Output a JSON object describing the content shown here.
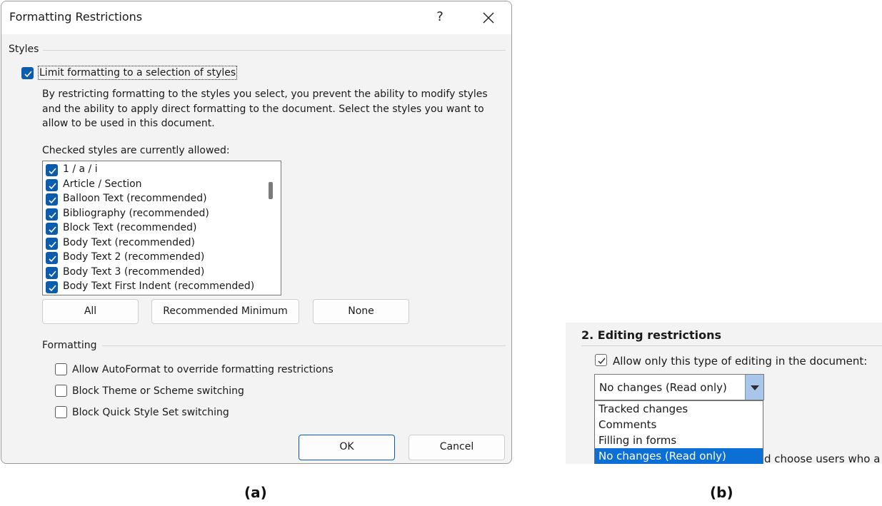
{
  "dialog": {
    "title": "Formatting Restrictions",
    "help_label": "?",
    "styles_group": "Styles",
    "limit_checkbox": {
      "label": "Limit formatting to a selection of styles",
      "checked": true
    },
    "description": "By restricting formatting to the styles you select, you prevent the ability to modify styles and the ability to apply direct formatting to the document. Select the styles you want to allow to be used in this document.",
    "list_caption": "Checked styles are currently allowed:",
    "styles_list": [
      {
        "label": "1 / a / i",
        "checked": true
      },
      {
        "label": "Article / Section",
        "checked": true
      },
      {
        "label": "Balloon Text (recommended)",
        "checked": true
      },
      {
        "label": "Bibliography (recommended)",
        "checked": true
      },
      {
        "label": "Block Text (recommended)",
        "checked": true
      },
      {
        "label": "Body Text (recommended)",
        "checked": true
      },
      {
        "label": "Body Text 2 (recommended)",
        "checked": true
      },
      {
        "label": "Body Text 3 (recommended)",
        "checked": true
      },
      {
        "label": "Body Text First Indent (recommended)",
        "checked": true
      }
    ],
    "buttons": {
      "all": "All",
      "recommended_minimum": "Recommended Minimum",
      "none": "None"
    },
    "formatting_group": "Formatting",
    "formatting_options": [
      {
        "label": "Allow AutoFormat to override formatting restrictions",
        "checked": false
      },
      {
        "label": "Block Theme or Scheme switching",
        "checked": false
      },
      {
        "label": "Block Quick Style Set switching",
        "checked": false
      }
    ],
    "ok": "OK",
    "cancel": "Cancel"
  },
  "panel": {
    "heading": "2. Editing restrictions",
    "allow_checkbox": {
      "label": "Allow only this type of editing in the document:",
      "checked": true
    },
    "combo_value": "No changes (Read only)",
    "options": [
      "Tracked changes",
      "Comments",
      "Filling in forms",
      "No changes (Read only)"
    ],
    "selected_option": "No changes (Read only)",
    "partial_text": "d choose users who a"
  },
  "captions": {
    "a": "(a)",
    "b": "(b)"
  },
  "colors": {
    "accent": "#0b5cad",
    "selection": "#0b6fd6",
    "dialog_bg": "#f3f3f3"
  },
  "icons": {
    "check": "check-icon",
    "close": "close-icon",
    "dropdown": "dropdown-arrow-icon"
  }
}
